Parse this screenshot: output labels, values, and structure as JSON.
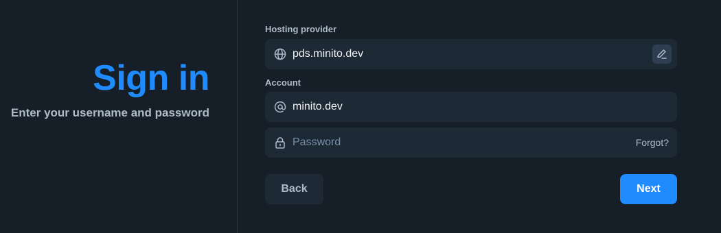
{
  "header": {
    "title": "Sign in",
    "subtitle": "Enter your username and password"
  },
  "hosting": {
    "label": "Hosting provider",
    "value": "pds.minito.dev",
    "icon": "globe-icon",
    "edit_icon": "pencil-icon"
  },
  "account": {
    "label": "Account",
    "username_value": "minito.dev",
    "username_icon": "at-icon",
    "password_placeholder": "Password",
    "password_icon": "lock-icon",
    "forgot_label": "Forgot?"
  },
  "actions": {
    "back_label": "Back",
    "next_label": "Next"
  },
  "colors": {
    "background": "#161e27",
    "accent": "#208bfe",
    "field_bg": "#1e2936",
    "muted_text": "#aebbc9"
  }
}
